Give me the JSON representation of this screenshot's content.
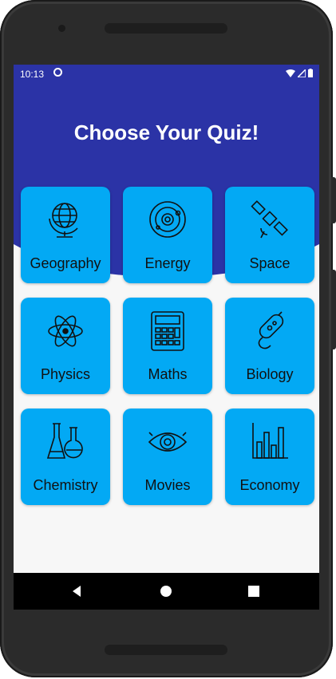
{
  "status_bar": {
    "time": "10:13"
  },
  "header": {
    "title": "Choose Your Quiz!"
  },
  "colors": {
    "header": "#2b33a6",
    "card": "#03a9f4",
    "background": "#f7f7f7"
  },
  "quizzes": [
    {
      "label": "Geography",
      "icon": "globe-icon"
    },
    {
      "label": "Energy",
      "icon": "orbit-icon"
    },
    {
      "label": "Space",
      "icon": "satellite-icon"
    },
    {
      "label": "Physics",
      "icon": "atom-icon"
    },
    {
      "label": "Maths",
      "icon": "calculator-icon"
    },
    {
      "label": "Biology",
      "icon": "bacteria-icon"
    },
    {
      "label": "Chemistry",
      "icon": "flasks-icon"
    },
    {
      "label": "Movies",
      "icon": "eye-icon"
    },
    {
      "label": "Economy",
      "icon": "bar-chart-icon"
    }
  ],
  "nav": {
    "back": "back-icon",
    "home": "home-icon",
    "recents": "recents-icon"
  }
}
